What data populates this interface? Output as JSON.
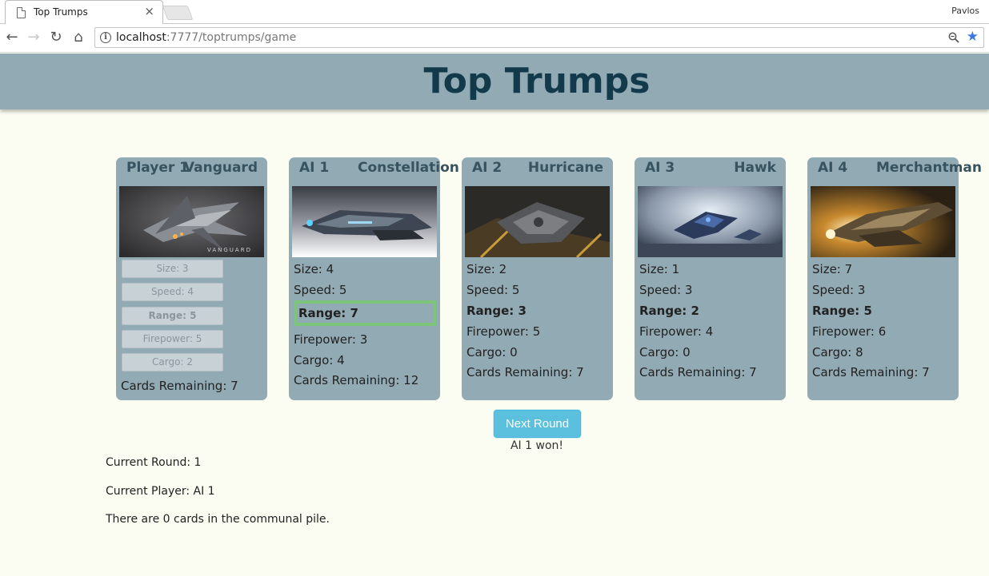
{
  "browser": {
    "tab_title": "Top Trumps",
    "tab_close": "×",
    "profile_name": "Pavlos",
    "url_host": "localhost",
    "url_path": ":7777/toptrumps/game"
  },
  "header": {
    "title": "Top Trumps"
  },
  "cards": [
    {
      "owner": "Player 1",
      "name": "Vanguard",
      "image_label": "VANGUARD",
      "stats": [
        "Size: 3",
        "Speed: 4",
        "Range: 5",
        "Firepower: 5",
        "Cargo: 2"
      ],
      "cards_remaining": "Cards Remaining: 7"
    },
    {
      "owner": "AI 1",
      "name": "Constellation",
      "stats": [
        "Size: 4",
        "Speed: 5",
        "Range: 7",
        "Firepower: 3",
        "Cargo: 4"
      ],
      "cards_remaining": "Cards Remaining: 12"
    },
    {
      "owner": "AI 2",
      "name": "Hurricane",
      "stats": [
        "Size: 2",
        "Speed: 5",
        "Range: 3",
        "Firepower: 5",
        "Cargo: 0"
      ],
      "cards_remaining": "Cards Remaining: 7"
    },
    {
      "owner": "AI 3",
      "name": "Hawk",
      "stats": [
        "Size: 1",
        "Speed: 3",
        "Range: 2",
        "Firepower: 4",
        "Cargo: 0"
      ],
      "cards_remaining": "Cards Remaining: 7"
    },
    {
      "owner": "AI 4",
      "name": "Merchantman",
      "stats": [
        "Size: 7",
        "Speed: 3",
        "Range: 5",
        "Firepower: 6",
        "Cargo: 8"
      ],
      "cards_remaining": "Cards Remaining: 7"
    }
  ],
  "controls": {
    "next_round_label": "Next Round",
    "result": "AI 1 won!"
  },
  "status": {
    "current_round": "Current Round: 1",
    "current_player": "Current Player: AI 1",
    "communal_pile": "There are 0 cards in the communal pile."
  },
  "colors": {
    "header_bg": "#91aab4",
    "title": "#123a4a",
    "card_bg": "#91aab4",
    "highlight": "#7cc47a",
    "button": "#5bc0de"
  }
}
